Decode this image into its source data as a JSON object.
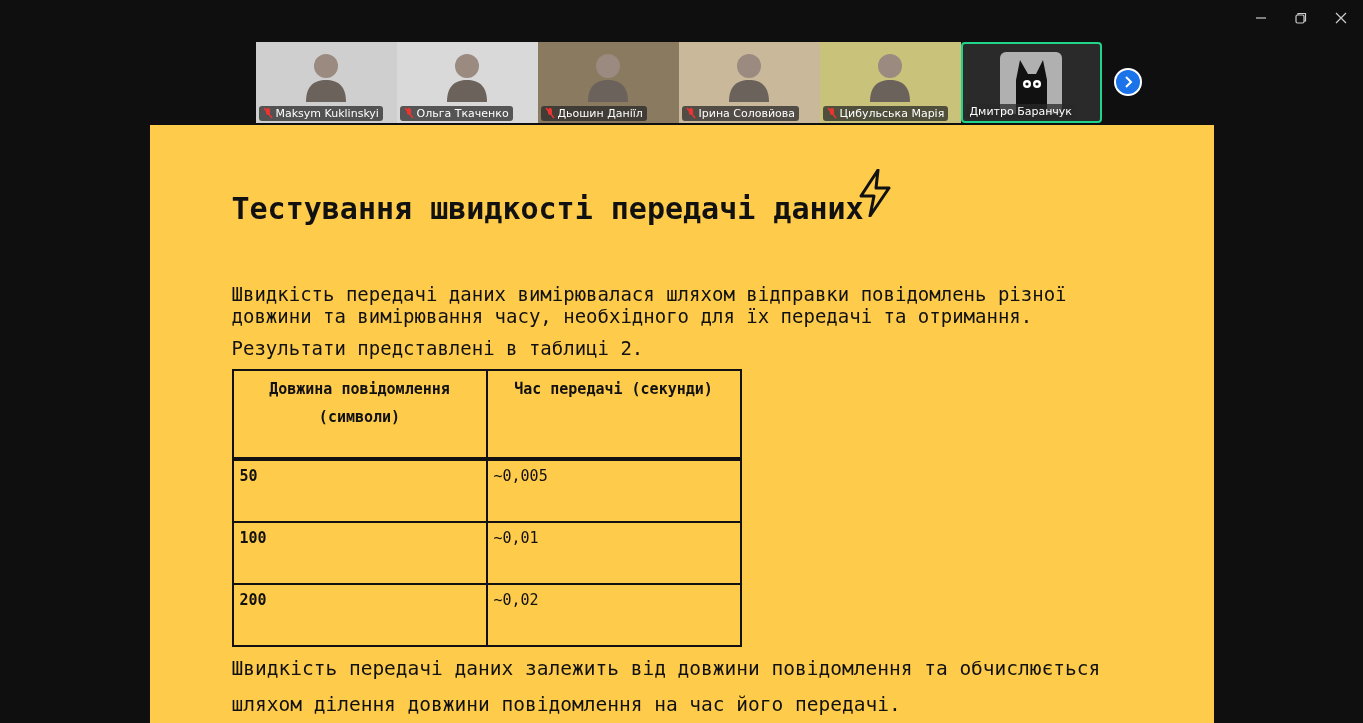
{
  "participants": [
    {
      "name": "Maksym Kuklinskyi",
      "muted": true,
      "selected": false,
      "kind": "video"
    },
    {
      "name": "Ольга Ткаченко",
      "muted": true,
      "selected": false,
      "kind": "video"
    },
    {
      "name": "Дьошин Даніїл",
      "muted": true,
      "selected": false,
      "kind": "video"
    },
    {
      "name": "Ірина Соловйова",
      "muted": true,
      "selected": false,
      "kind": "video"
    },
    {
      "name": "Цибульська Марія",
      "muted": true,
      "selected": false,
      "kind": "video"
    },
    {
      "name": "Дмитро Баранчук",
      "muted": false,
      "selected": true,
      "kind": "avatar"
    }
  ],
  "slide": {
    "title": "Тестування швидкості передачі даних",
    "intro": [
      "Швидкість передачі даних вимірювалася шляхом відправки повідомлень різної довжини та вимірювання часу, необхідного для їх передачі та отримання.",
      "Результати представлені в таблиці 2."
    ],
    "table": {
      "columns": [
        "Довжина повідомлення (символи)",
        "Час передачі (секунди)"
      ],
      "rows": [
        [
          "50",
          "~0,005"
        ],
        [
          "100",
          "~0,01"
        ],
        [
          "200",
          "~0,02"
        ]
      ]
    },
    "conclusion": "Швидкість передачі даних залежить від довжини повідомлення та обчислюється шляхом ділення довжини повідомлення на час його передачі."
  }
}
